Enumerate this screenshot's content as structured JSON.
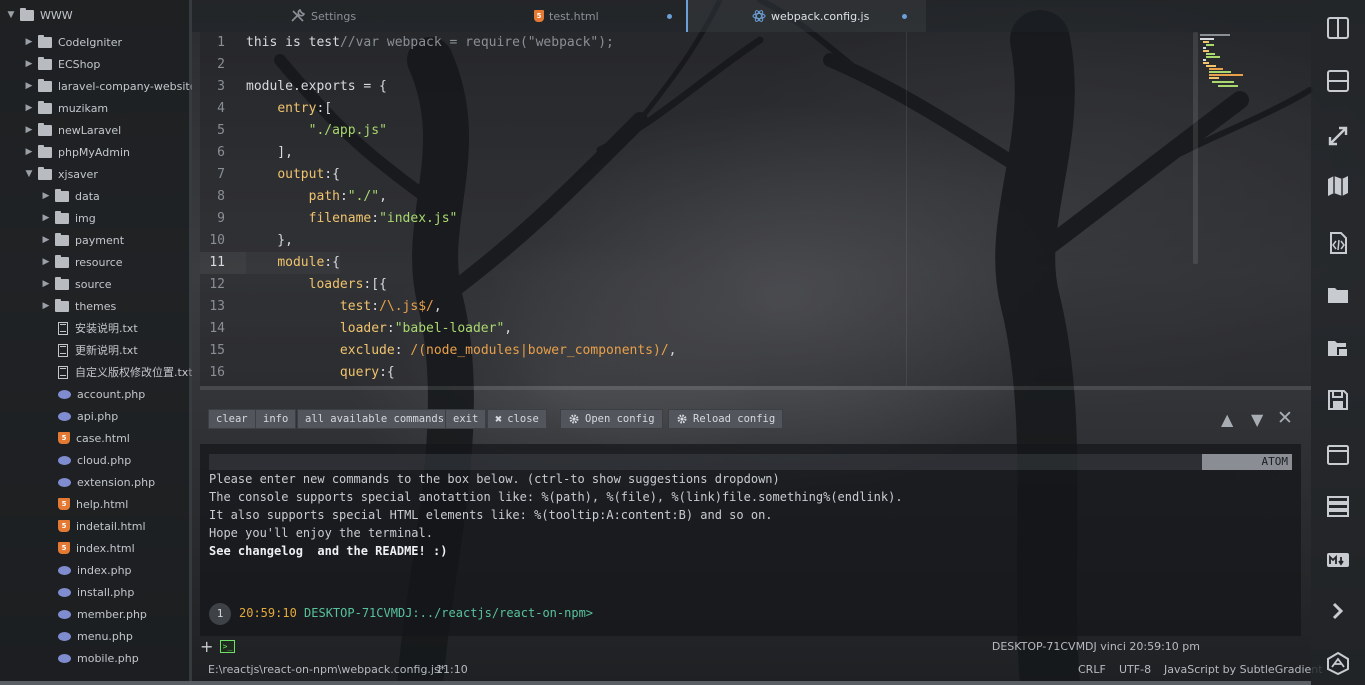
{
  "tree": {
    "root": "WWW",
    "items": [
      {
        "label": "CodeIgniter",
        "type": "folder",
        "depth": 1,
        "open": false
      },
      {
        "label": "ECShop",
        "type": "folder",
        "depth": 1,
        "open": false
      },
      {
        "label": "laravel-company-website",
        "type": "folder",
        "depth": 1,
        "open": false
      },
      {
        "label": "muzikam",
        "type": "folder",
        "depth": 1,
        "open": false
      },
      {
        "label": "newLaravel",
        "type": "folder",
        "depth": 1,
        "open": false
      },
      {
        "label": "phpMyAdmin",
        "type": "folder",
        "depth": 1,
        "open": false
      },
      {
        "label": "xjsaver",
        "type": "folder",
        "depth": 1,
        "open": true
      },
      {
        "label": "data",
        "type": "folder",
        "depth": 2,
        "open": false
      },
      {
        "label": "img",
        "type": "folder",
        "depth": 2,
        "open": false
      },
      {
        "label": "payment",
        "type": "folder",
        "depth": 2,
        "open": false
      },
      {
        "label": "resource",
        "type": "folder",
        "depth": 2,
        "open": false
      },
      {
        "label": "source",
        "type": "folder",
        "depth": 2,
        "open": false
      },
      {
        "label": "themes",
        "type": "folder",
        "depth": 2,
        "open": false
      },
      {
        "label": "安装说明.txt",
        "type": "txt",
        "depth": 2
      },
      {
        "label": "更新说明.txt",
        "type": "txt",
        "depth": 2
      },
      {
        "label": "自定义版权修改位置.txt",
        "type": "txt",
        "depth": 2
      },
      {
        "label": "account.php",
        "type": "php",
        "depth": 2
      },
      {
        "label": "api.php",
        "type": "php",
        "depth": 2
      },
      {
        "label": "case.html",
        "type": "html",
        "depth": 2
      },
      {
        "label": "cloud.php",
        "type": "php",
        "depth": 2
      },
      {
        "label": "extension.php",
        "type": "php",
        "depth": 2
      },
      {
        "label": "help.html",
        "type": "html",
        "depth": 2
      },
      {
        "label": "indetail.html",
        "type": "html",
        "depth": 2
      },
      {
        "label": "index.html",
        "type": "html",
        "depth": 2
      },
      {
        "label": "index.php",
        "type": "php",
        "depth": 2
      },
      {
        "label": "install.php",
        "type": "php",
        "depth": 2
      },
      {
        "label": "member.php",
        "type": "php",
        "depth": 2
      },
      {
        "label": "menu.php",
        "type": "php",
        "depth": 2
      },
      {
        "label": "mobile.php",
        "type": "php",
        "depth": 2
      }
    ]
  },
  "tabs": [
    {
      "label": "Settings",
      "icon": "wrench-icon",
      "active": false,
      "modified": false
    },
    {
      "label": "test.html",
      "icon": "html-icon",
      "active": false,
      "modified": true
    },
    {
      "label": "webpack.config.js",
      "icon": "atom-icon",
      "active": true,
      "modified": true
    }
  ],
  "editor": {
    "current_line": 11,
    "lines": [
      [
        [
          "k",
          "this is "
        ],
        [
          "w",
          "test"
        ],
        [
          "c",
          "//var webpack = require(\"webpack\");"
        ]
      ],
      [],
      [
        [
          "w",
          "module.exports = {"
        ]
      ],
      [
        [
          "w",
          "    "
        ],
        [
          "p",
          "entry"
        ],
        [
          "w",
          ":["
        ]
      ],
      [
        [
          "w",
          "        "
        ],
        [
          "s",
          "\"./app.js\""
        ]
      ],
      [
        [
          "w",
          "    ],"
        ]
      ],
      [
        [
          "w",
          "    "
        ],
        [
          "p",
          "output"
        ],
        [
          "w",
          ":{"
        ]
      ],
      [
        [
          "w",
          "        "
        ],
        [
          "p",
          "path"
        ],
        [
          "w",
          ":"
        ],
        [
          "s",
          "\"./\""
        ],
        [
          "w",
          ","
        ]
      ],
      [
        [
          "w",
          "        "
        ],
        [
          "p",
          "filename"
        ],
        [
          "w",
          ":"
        ],
        [
          "s",
          "\"index.js\""
        ]
      ],
      [
        [
          "w",
          "    },"
        ]
      ],
      [
        [
          "w",
          "    "
        ],
        [
          "p",
          "module"
        ],
        [
          "w",
          ":{"
        ]
      ],
      [
        [
          "w",
          "        "
        ],
        [
          "p",
          "loaders"
        ],
        [
          "w",
          ":[{"
        ]
      ],
      [
        [
          "w",
          "            "
        ],
        [
          "p",
          "test"
        ],
        [
          "w",
          ":"
        ],
        [
          "r",
          "/\\.js$/"
        ],
        [
          "w",
          ","
        ]
      ],
      [
        [
          "w",
          "            "
        ],
        [
          "p",
          "loader"
        ],
        [
          "w",
          ":"
        ],
        [
          "s",
          "\"babel-loader\""
        ],
        [
          "w",
          ","
        ]
      ],
      [
        [
          "w",
          "            "
        ],
        [
          "p",
          "exclude"
        ],
        [
          "w",
          ": "
        ],
        [
          "r",
          "/(node_modules|bower_components)/"
        ],
        [
          "w",
          ","
        ]
      ],
      [
        [
          "w",
          "            "
        ],
        [
          "p",
          "query"
        ],
        [
          "w",
          ":{"
        ]
      ]
    ]
  },
  "terminal": {
    "buttons": {
      "clear": "clear",
      "info": "info",
      "all": "all available commands",
      "exit": "exit",
      "close": "close",
      "open_config": "Open config",
      "reload_config": "Reload config"
    },
    "title": "ATOM Terminal",
    "lines": [
      "Please enter new commands to the box below. (ctrl-to show suggestions dropdown)",
      "The console supports special anotattion like: %(path), %(file), %(link)file.something%(endlink).",
      "It also supports special HTML elements like: %(tooltip:A:content:B) and so on.",
      "Hope you'll enjoy the terminal."
    ],
    "last_line_bold1": "See changelog",
    "last_line_bold2": "and the README! :)",
    "prompt_number": "1",
    "prompt_time": "20:59:10",
    "prompt_host": "DESKTOP-71CVMDJ:",
    "prompt_path": "../reactjs/react-on-npm>",
    "status_text": "DESKTOP-71CVMDJ vinci 20:59:10 pm",
    "tab_glyph": ">_"
  },
  "statusbar": {
    "path": "E:\\reactjs\\react-on-npm\\webpack.config.js*",
    "cursor": "11:10",
    "line_ending": "CRLF",
    "encoding": "UTF-8",
    "grammar": "JavaScript by SubtleGradient"
  },
  "toolbar_icons": [
    "split-vertical-icon",
    "split-horizontal-icon",
    "fullscreen-icon",
    "map-icon",
    "code-file-icon",
    "folder-icon",
    "folder-open-icon",
    "save-icon",
    "window-icon",
    "list-icon",
    "markdown-icon",
    "chevron-right-icon",
    "atom-logo-icon"
  ],
  "colors": {
    "accent": "#6a9fd8",
    "string": "#a9d86e",
    "property": "#f0c36d",
    "regex": "#e8a04a",
    "terminal_tab": "#6fe06a"
  }
}
